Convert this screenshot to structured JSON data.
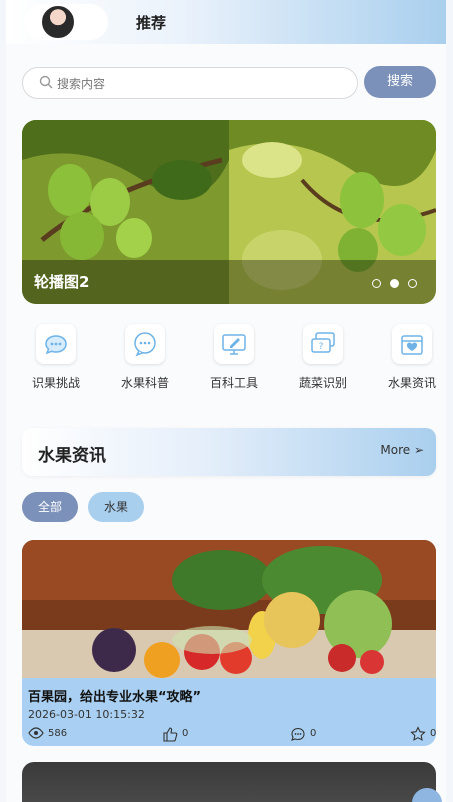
{
  "header": {
    "title": "推荐"
  },
  "search": {
    "placeholder": "搜索内容",
    "button_label": "搜索"
  },
  "banner": {
    "caption": "轮播图2",
    "slide_count": 3,
    "active_slide": 2
  },
  "features": [
    {
      "label": "识果挑战",
      "icon": "chat-bubble-icon"
    },
    {
      "label": "水果科普",
      "icon": "message-dots-icon"
    },
    {
      "label": "百科工具",
      "icon": "monitor-edit-icon"
    },
    {
      "label": "蔬菜识别",
      "icon": "question-chat-icon"
    },
    {
      "label": "水果资讯",
      "icon": "box-heart-icon"
    }
  ],
  "news": {
    "title": "水果资讯",
    "more_label": "More ➢",
    "filters": [
      {
        "label": "全部",
        "active": true
      },
      {
        "label": "水果",
        "active": false
      }
    ],
    "items": [
      {
        "title": "百果园，给出专业水果“攻略”",
        "date": "2026-03-01 10:15:32",
        "views": "586",
        "likes": "0",
        "comments": "0",
        "favorites": "0"
      }
    ]
  },
  "colors": {
    "accent": "#7b91b9",
    "light_blue": "#a9cfee",
    "card_bg": "#a9d0f2"
  }
}
